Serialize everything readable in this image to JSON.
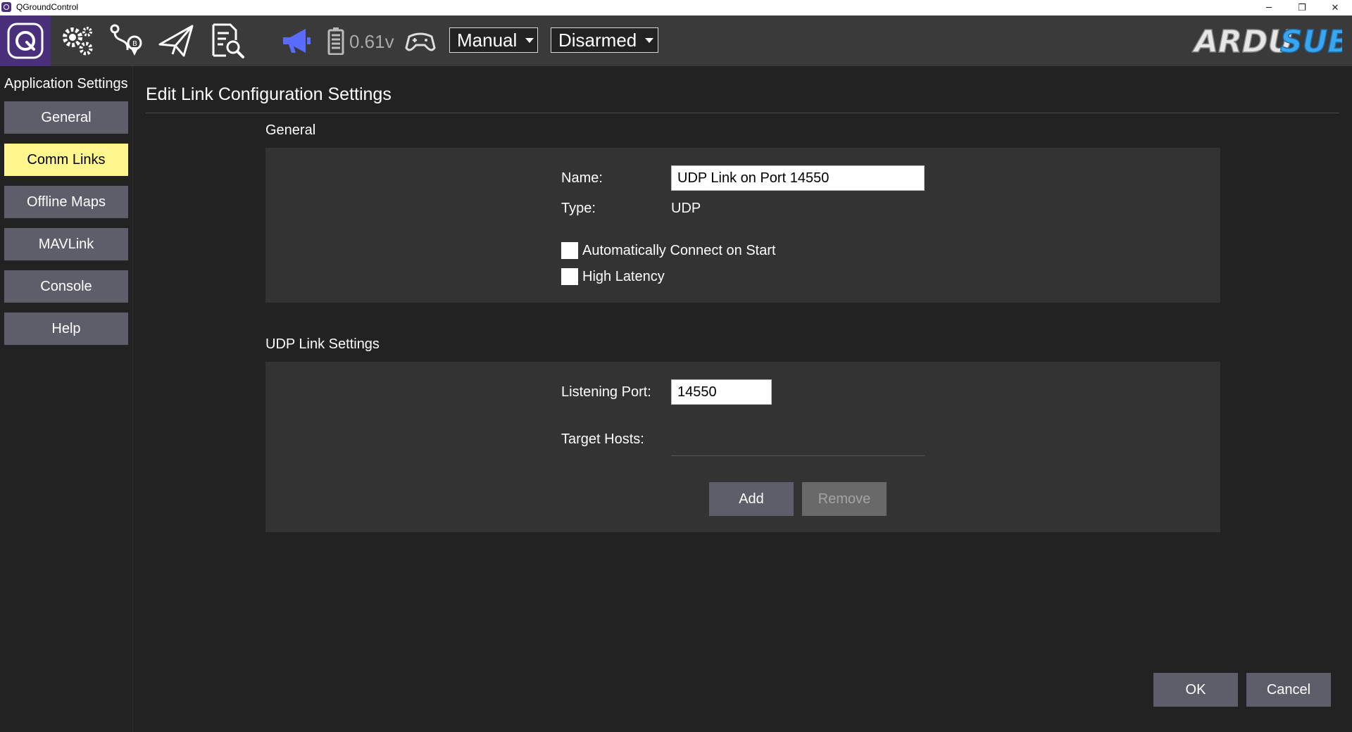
{
  "window": {
    "title": "QGroundControl",
    "minimize_glyph": "─",
    "restore_glyph": "❐",
    "close_glyph": "✕"
  },
  "toolbar": {
    "icons": [
      "qgc-logo-icon",
      "settings-gears-icon",
      "plan-route-icon",
      "fly-paper-plane-icon",
      "analyze-document-icon",
      "messages-megaphone-icon",
      "battery-icon",
      "joystick-icon"
    ],
    "voltage": "0.61v",
    "flight_mode": "Manual",
    "arm_state": "Disarmed",
    "brand": "ARDUSUB",
    "brand_part1": "ARDU",
    "brand_part2": "SUB"
  },
  "sidebar": {
    "heading": "Application Settings",
    "items": [
      {
        "label": "General",
        "active": false
      },
      {
        "label": "Comm Links",
        "active": true
      },
      {
        "label": "Offline Maps",
        "active": false
      },
      {
        "label": "MAVLink",
        "active": false
      },
      {
        "label": "Console",
        "active": false
      },
      {
        "label": "Help",
        "active": false
      }
    ]
  },
  "main": {
    "title": "Edit Link Configuration Settings",
    "general": {
      "section_label": "General",
      "name_label": "Name:",
      "name_value": "UDP Link on Port 14550",
      "type_label": "Type:",
      "type_value": "UDP",
      "auto_connect_label": "Automatically Connect on Start",
      "high_latency_label": "High Latency"
    },
    "udp": {
      "section_label": "UDP Link Settings",
      "port_label": "Listening Port:",
      "port_value": "14550",
      "target_hosts_label": "Target Hosts:",
      "add_label": "Add",
      "remove_label": "Remove"
    },
    "ok_label": "OK",
    "cancel_label": "Cancel"
  },
  "colors": {
    "background": "#222222",
    "toolbar": "#3a3a3a",
    "logo_accent": "#4a2f7a",
    "active_nav": "#fff78e",
    "button": "#5e5e6a",
    "panel": "#333333",
    "megaphone": "#5a6cff"
  }
}
